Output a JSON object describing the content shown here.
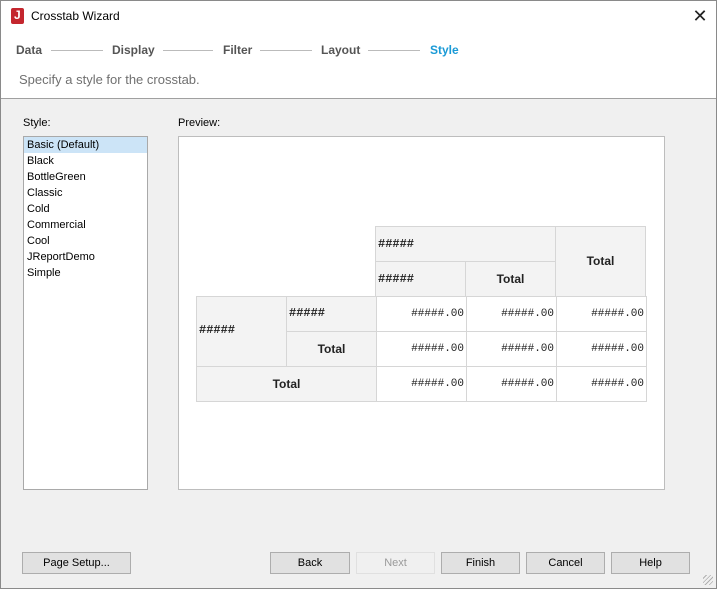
{
  "window": {
    "title": "Crosstab Wizard",
    "close_glyph": "✕"
  },
  "steps": [
    {
      "label": "Data"
    },
    {
      "label": "Display"
    },
    {
      "label": "Filter"
    },
    {
      "label": "Layout"
    },
    {
      "label": "Style",
      "active": true
    }
  ],
  "subtitle": "Specify a style for the crosstab.",
  "style_panel": {
    "label": "Style:",
    "items": [
      "Basic (Default)",
      "Black",
      "BottleGreen",
      "Classic",
      "Cold",
      "Commercial",
      "Cool",
      "JReportDemo",
      "Simple"
    ],
    "selected": "Basic (Default)"
  },
  "preview": {
    "label": "Preview:",
    "hash": "#####",
    "total": "Total",
    "value": "#####.00"
  },
  "buttons": {
    "page_setup": "Page Setup...",
    "back": "Back",
    "next": "Next",
    "finish": "Finish",
    "cancel": "Cancel",
    "help": "Help"
  },
  "colors": {
    "accent": "#1a9ad6",
    "selection": "#cce4f7",
    "header_cell": "#f3f3f3"
  }
}
